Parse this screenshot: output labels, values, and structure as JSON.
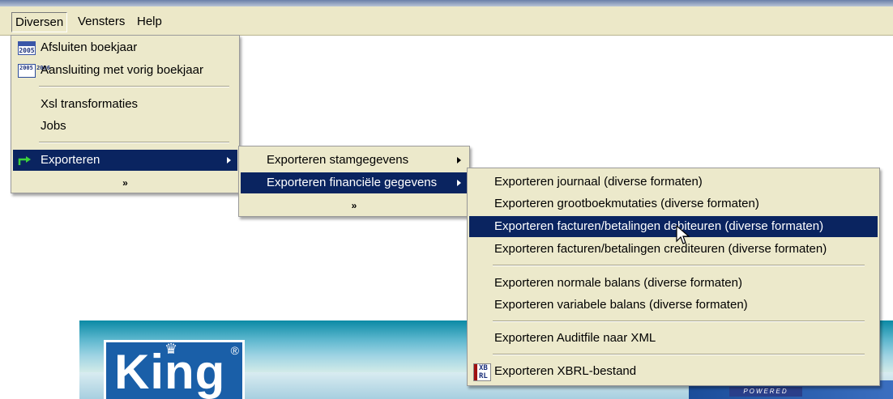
{
  "menubar": {
    "items": [
      {
        "label": "Diversen"
      },
      {
        "label": "Vensters"
      },
      {
        "label": "Help"
      }
    ]
  },
  "diversen_menu": {
    "items": [
      {
        "label": "Afsluiten boekjaar",
        "icon": "year-close-icon",
        "icon_text": "2005"
      },
      {
        "label": "Aansluiting met vorig boekjaar",
        "icon": "year-link-icon",
        "icon_text": "2005 2006"
      },
      {
        "label": "Xsl transformaties"
      },
      {
        "label": "Jobs"
      },
      {
        "label": "Exporteren",
        "icon": "export-arrow-icon"
      }
    ],
    "expand": "»"
  },
  "exporteren_menu": {
    "items": [
      {
        "label": "Exporteren stamgegevens"
      },
      {
        "label": "Exporteren financiële gegevens"
      }
    ],
    "expand": "»"
  },
  "financieel_menu": {
    "items": [
      {
        "label": "Exporteren journaal (diverse formaten)"
      },
      {
        "label": "Exporteren grootboekmutaties (diverse formaten)"
      },
      {
        "label": "Exporteren facturen/betalingen debiteuren (diverse formaten)"
      },
      {
        "label": "Exporteren facturen/betalingen crediteuren (diverse formaten)"
      },
      {
        "label": "Exporteren normale balans (diverse formaten)"
      },
      {
        "label": "Exporteren variabele balans (diverse formaten)"
      },
      {
        "label": "Exporteren Auditfile naar XML"
      },
      {
        "label": "Exporteren XBRL-bestand",
        "icon": "xbrl-icon",
        "icon_text_top": "XB",
        "icon_text_bottom": "RL"
      }
    ]
  },
  "banner": {
    "logo": "King",
    "registered": "®",
    "powered": "POWERED"
  },
  "colors": {
    "menu_bg": "#ece9cb",
    "highlight": "#0a2460",
    "banner_blue": "#1a5fa8"
  }
}
